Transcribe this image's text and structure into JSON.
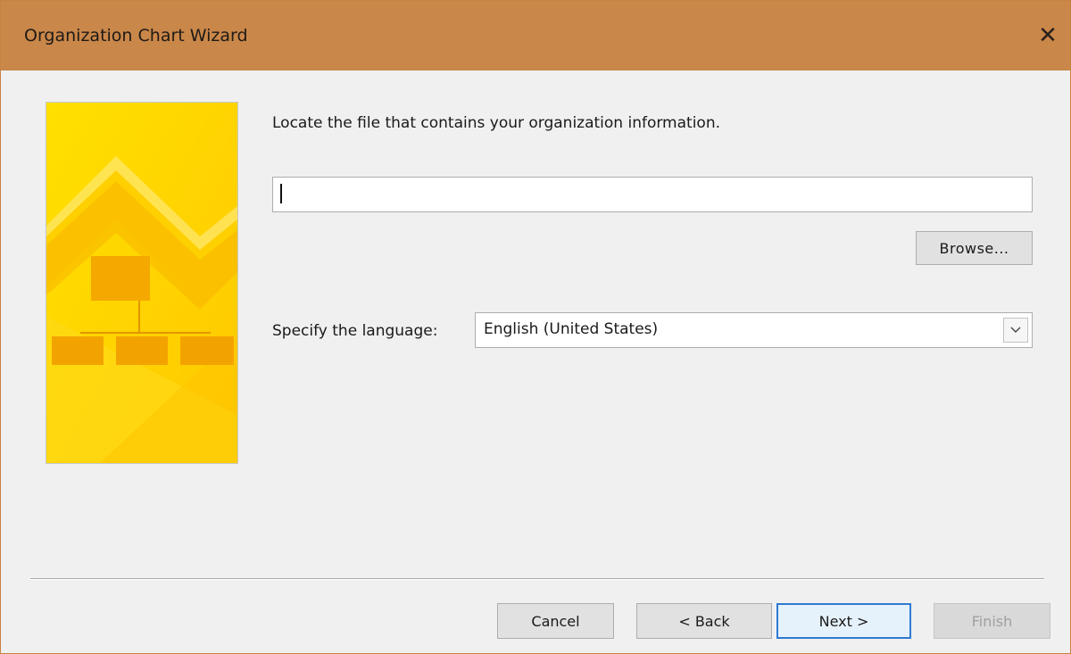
{
  "window": {
    "title": "Organization Chart Wizard",
    "close_glyph": "✕",
    "title_bar_color": "#c9874a",
    "accent_color": "#2f7ad1"
  },
  "main": {
    "instruction": "Locate the file that contains your organization information.",
    "file_path": {
      "value": "",
      "placeholder": ""
    },
    "browse_label": "Browse...",
    "language_label": "Specify the language:",
    "language_selected": "English (United States)"
  },
  "illustration": {
    "icon": "org-chart-illustration",
    "colors": {
      "base": "#ffd400",
      "dark": "#f5ab00",
      "light": "#ffe45c"
    }
  },
  "footer": {
    "cancel_label": "Cancel",
    "back_label": "< Back",
    "next_label": "Next >",
    "finish_label": "Finish"
  }
}
